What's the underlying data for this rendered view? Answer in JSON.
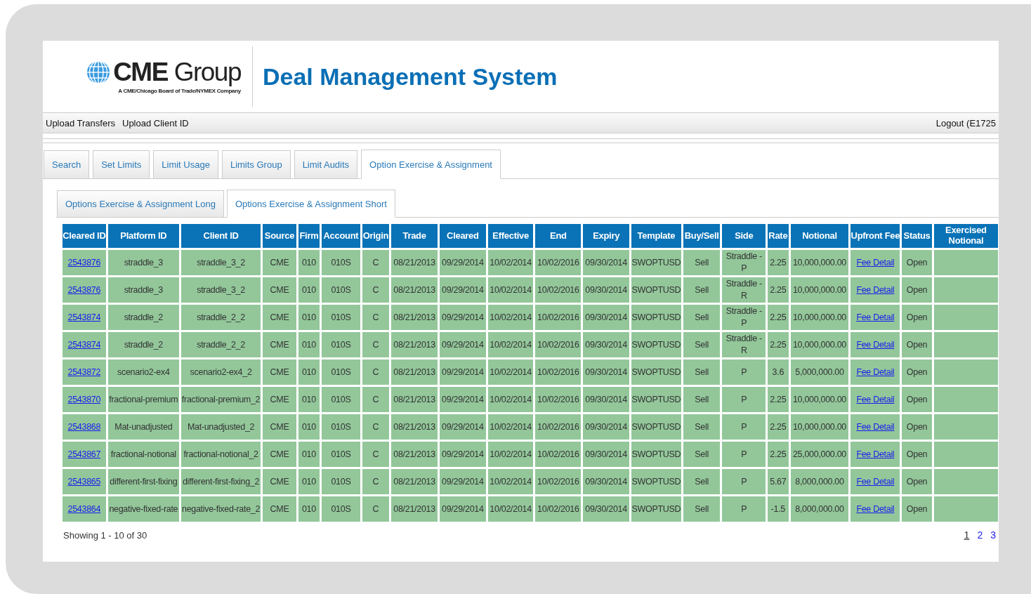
{
  "header": {
    "logo_name": "**CME** Group",
    "logo_tagline": "A CME/Chicago Board of Trade/NYMEX Company",
    "title": "Deal Management System"
  },
  "nav": {
    "links": [
      "Upload Transfers",
      "Upload Client ID"
    ],
    "logout": "Logout (E1725"
  },
  "tabs": [
    {
      "label": "Search",
      "selected": false
    },
    {
      "label": "Set Limits",
      "selected": false
    },
    {
      "label": "Limit Usage",
      "selected": false
    },
    {
      "label": "Limits Group",
      "selected": false
    },
    {
      "label": "Limit Audits",
      "selected": false
    },
    {
      "label": "Option Exercise & Assignment",
      "selected": true
    }
  ],
  "subtabs": [
    {
      "label": "Options Exercise & Assignment Long",
      "selected": false
    },
    {
      "label": "Options Exercise & Assignment Short",
      "selected": true
    }
  ],
  "table": {
    "columns": [
      {
        "label": "Cleared ID",
        "kind": "link"
      },
      {
        "label": "Platform ID",
        "kind": "text"
      },
      {
        "label": "Client ID",
        "kind": "text"
      },
      {
        "label": "Source",
        "kind": "text"
      },
      {
        "label": "Firm",
        "kind": "text"
      },
      {
        "label": "Account",
        "kind": "text"
      },
      {
        "label": "Origin",
        "kind": "text"
      },
      {
        "label": "Trade",
        "kind": "text"
      },
      {
        "label": "Cleared",
        "kind": "text"
      },
      {
        "label": "Effective",
        "kind": "text"
      },
      {
        "label": "End",
        "kind": "text"
      },
      {
        "label": "Expiry",
        "kind": "text"
      },
      {
        "label": "Template",
        "kind": "text"
      },
      {
        "label": "Buy/Sell",
        "kind": "text"
      },
      {
        "label": "Side",
        "kind": "text"
      },
      {
        "label": "Rate",
        "kind": "text"
      },
      {
        "label": "Notional",
        "kind": "text"
      },
      {
        "label": "Upfront Fee",
        "kind": "link"
      },
      {
        "label": "Status",
        "kind": "text"
      },
      {
        "label": "Exercised Notional"
      }
    ],
    "rows": [
      [
        "2543876",
        "straddle_3",
        "straddle_3_2",
        "CME",
        "010",
        "010S",
        "C",
        "08/21/2013",
        "09/29/2014",
        "10/02/2014",
        "10/02/2016",
        "09/30/2014",
        "SWOPTUSD",
        "Sell",
        "Straddle - P",
        "2.25",
        "10,000,000.00",
        "Fee Detail",
        "Open"
      ],
      [
        "2543876",
        "straddle_3",
        "straddle_3_2",
        "CME",
        "010",
        "010S",
        "C",
        "08/21/2013",
        "09/29/2014",
        "10/02/2014",
        "10/02/2016",
        "09/30/2014",
        "SWOPTUSD",
        "Sell",
        "Straddle - R",
        "2.25",
        "10,000,000.00",
        "Fee Detail",
        "Open"
      ],
      [
        "2543874",
        "straddle_2",
        "straddle_2_2",
        "CME",
        "010",
        "010S",
        "C",
        "08/21/2013",
        "09/29/2014",
        "10/02/2014",
        "10/02/2016",
        "09/30/2014",
        "SWOPTUSD",
        "Sell",
        "Straddle - P",
        "2.25",
        "10,000,000.00",
        "Fee Detail",
        "Open"
      ],
      [
        "2543874",
        "straddle_2",
        "straddle_2_2",
        "CME",
        "010",
        "010S",
        "C",
        "08/21/2013",
        "09/29/2014",
        "10/02/2014",
        "10/02/2016",
        "09/30/2014",
        "SWOPTUSD",
        "Sell",
        "Straddle - R",
        "2.25",
        "10,000,000.00",
        "Fee Detail",
        "Open"
      ],
      [
        "2543872",
        "scenario2-ex4",
        "scenario2-ex4_2",
        "CME",
        "010",
        "010S",
        "C",
        "08/21/2013",
        "09/29/2014",
        "10/02/2014",
        "10/02/2016",
        "09/30/2014",
        "SWOPTUSD",
        "Sell",
        "P",
        "3.6",
        "5,000,000.00",
        "Fee Detail",
        "Open"
      ],
      [
        "2543870",
        "fractional-premium",
        "fractional-premium_2",
        "CME",
        "010",
        "010S",
        "C",
        "08/21/2013",
        "09/29/2014",
        "10/02/2014",
        "10/02/2016",
        "09/30/2014",
        "SWOPTUSD",
        "Sell",
        "P",
        "2.25",
        "10,000,000.00",
        "Fee Detail",
        "Open"
      ],
      [
        "2543868",
        "Mat-unadjusted",
        "Mat-unadjusted_2",
        "CME",
        "010",
        "010S",
        "C",
        "08/21/2013",
        "09/29/2014",
        "10/02/2014",
        "10/02/2016",
        "09/30/2014",
        "SWOPTUSD",
        "Sell",
        "P",
        "2.25",
        "10,000,000.00",
        "Fee Detail",
        "Open"
      ],
      [
        "2543867",
        "fractional-notional",
        "fractional-notional_2",
        "CME",
        "010",
        "010S",
        "C",
        "08/21/2013",
        "09/29/2014",
        "10/02/2014",
        "10/02/2016",
        "09/30/2014",
        "SWOPTUSD",
        "Sell",
        "P",
        "2.25",
        "25,000,000.00",
        "Fee Detail",
        "Open"
      ],
      [
        "2543865",
        "different-first-fixing",
        "different-first-fixing_2",
        "CME",
        "010",
        "010S",
        "C",
        "08/21/2013",
        "09/29/2014",
        "10/02/2014",
        "10/02/2016",
        "09/30/2014",
        "SWOPTUSD",
        "Sell",
        "P",
        "5.67",
        "8,000,000.00",
        "Fee Detail",
        "Open"
      ],
      [
        "2543864",
        "negative-fixed-rate",
        "negative-fixed-rate_2",
        "CME",
        "010",
        "010S",
        "C",
        "08/21/2013",
        "09/29/2014",
        "10/02/2014",
        "10/02/2016",
        "09/30/2014",
        "SWOPTUSD",
        "Sell",
        "P",
        "-1.5",
        "8,000,000.00",
        "Fee Detail",
        "Open"
      ]
    ]
  },
  "footer": {
    "showing": "Showing 1 - 10 of 30",
    "pages": [
      {
        "label": "1",
        "selected": true
      },
      {
        "label": "2",
        "selected": false
      },
      {
        "label": "3",
        "selected": false
      }
    ]
  }
}
